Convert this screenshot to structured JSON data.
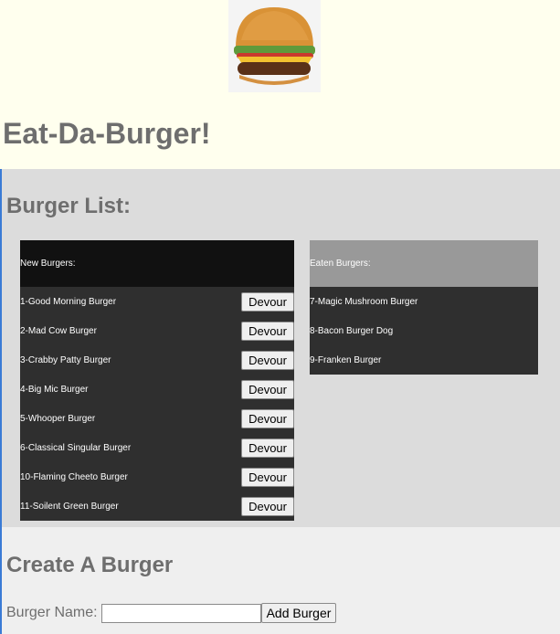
{
  "header": {
    "title": "Eat-Da-Burger!",
    "logo_icon": "burger-icon"
  },
  "burger_list": {
    "heading": "Burger List:",
    "new_panel": {
      "header": "New Burgers:",
      "button_label": "Devour",
      "items": [
        "1-Good Morning Burger",
        "2-Mad Cow Burger",
        "3-Crabby Patty Burger",
        "4-Big Mic Burger",
        "5-Whooper Burger",
        "6-Classical Singular Burger",
        "10-Flaming Cheeto Burger",
        "11-Soilent Green Burger"
      ]
    },
    "eaten_panel": {
      "header": "Eaten Burgers:",
      "items": [
        "7-Magic Mushroom Burger",
        "8-Bacon Burger Dog",
        "9-Franken Burger"
      ]
    }
  },
  "create": {
    "heading": "Create A Burger",
    "name_label": "Burger Name:",
    "name_value": "",
    "submit_label": "Add Burger"
  },
  "colors": {
    "page_bg": "#ffffee",
    "list_bg": "#dcdcdc",
    "create_bg": "#efefef",
    "heading_text": "#6e6e6e",
    "panel_bg": "#2f2f2f",
    "new_header_bg": "#111111",
    "eaten_header_bg": "#999999"
  }
}
